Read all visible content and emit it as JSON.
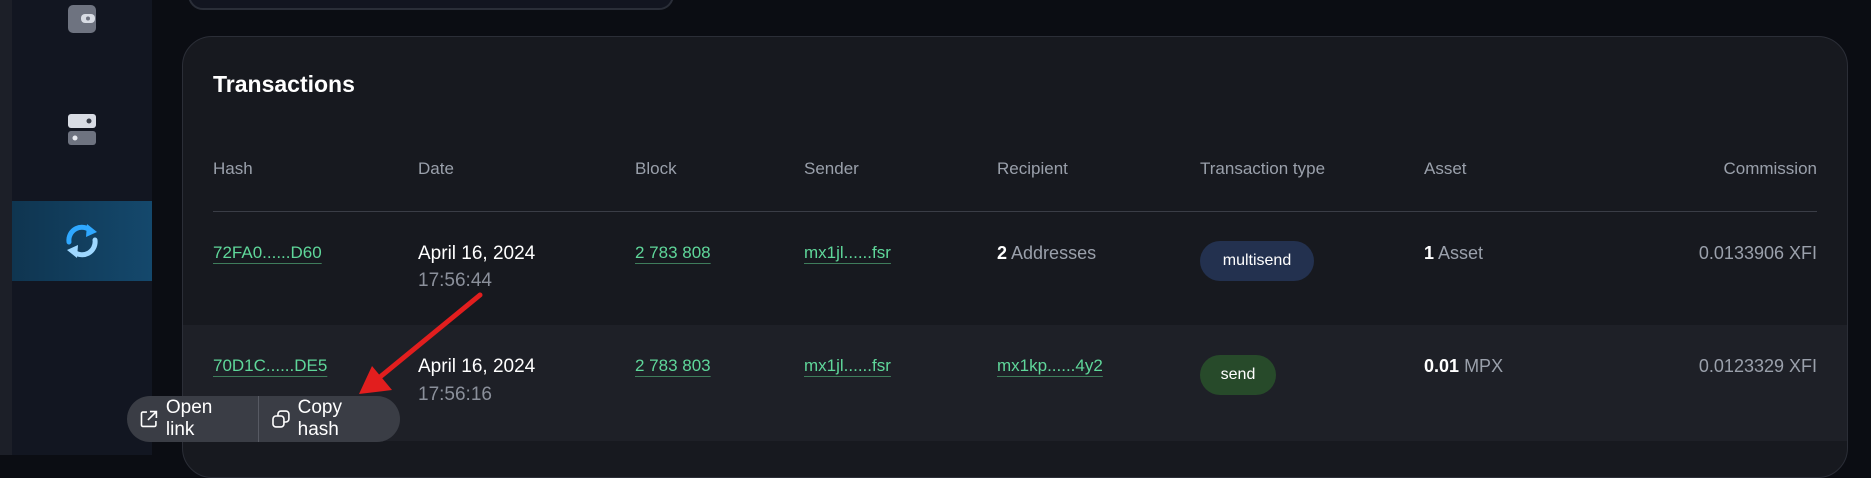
{
  "sidebar": {
    "items": [
      {
        "icon": "wallet-icon",
        "active": false
      },
      {
        "icon": "server-icon",
        "active": false
      },
      {
        "icon": "exchange-icon",
        "active": true
      }
    ]
  },
  "transactions": {
    "title": "Transactions",
    "columns": [
      "Hash",
      "Date",
      "Block",
      "Sender",
      "Recipient",
      "Transaction type",
      "Asset",
      "Commission"
    ],
    "rows": [
      {
        "hash": "72FA0......D60",
        "date": "April 16, 2024",
        "time": "17:56:44",
        "block": "2 783 808",
        "sender": "mx1jl......fsr",
        "recipient_count": "2",
        "recipient_label": "Addresses",
        "type": "multisend",
        "asset_amount": "1",
        "asset_label": "Asset",
        "commission": "0.0133906 XFI"
      },
      {
        "hash": "70D1C......DE5",
        "date": "April 16, 2024",
        "time": "17:56:16",
        "block": "2 783 803",
        "sender": "mx1jl......fsr",
        "recipient": "mx1kp......4y2",
        "type": "send",
        "asset_amount": "0.01",
        "asset_label": "MPX",
        "commission": "0.0123329 XFI"
      }
    ]
  },
  "popup": {
    "open_link": "Open link",
    "copy_hash": "Copy hash"
  },
  "colors": {
    "link": "#5fd79a",
    "badge_multisend": "#23314f",
    "badge_send": "#274a2a",
    "arrow": "#e21e1e"
  }
}
